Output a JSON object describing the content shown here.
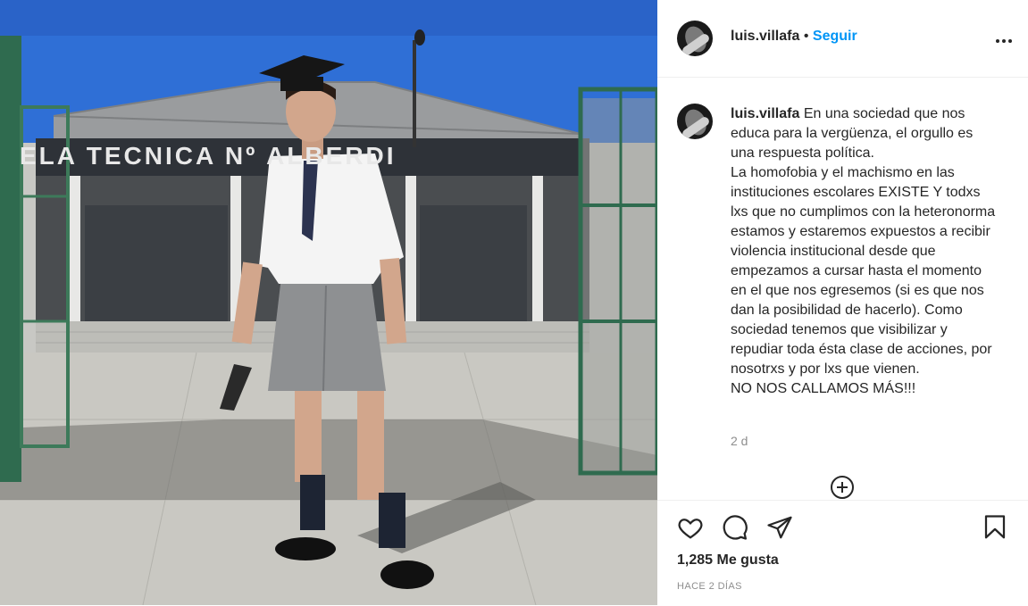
{
  "post": {
    "username": "luis.villafa",
    "dot": "•",
    "follow_label": "Seguir",
    "more_label": "•••",
    "caption": "En una sociedad que nos educa para la vergüenza, el orgullo es una respuesta política.\nLa homofobia y el machismo en las instituciones escolares EXISTE Y todxs lxs que no cumplimos con la heteronorma estamos y estaremos expuestos a recibir violencia institucional desde que empezamos a cursar hasta el momento en el que nos egresemos (si es que nos dan la posibilidad de hacerlo). Como sociedad tenemos que visibilizar y repudiar toda ésta clase de acciones, por nosotrxs y por lxs que vienen.\nNO NOS CALLAMOS MÁS!!!",
    "caption_age": "2 d",
    "likes": "1,285 Me gusta",
    "date": "HACE 2 DÍAS",
    "sign_text": "ELA TECNICA Nº ALBERDI"
  },
  "icons": {
    "like": "heart-icon",
    "comment": "comment-icon",
    "share": "paper-plane-icon",
    "save": "bookmark-icon",
    "load_more": "plus-circle-icon",
    "options": "more-options-icon"
  },
  "colors": {
    "follow": "#0095f6",
    "text": "#262626",
    "secondary": "#8e8e8e",
    "border": "#efefef"
  }
}
